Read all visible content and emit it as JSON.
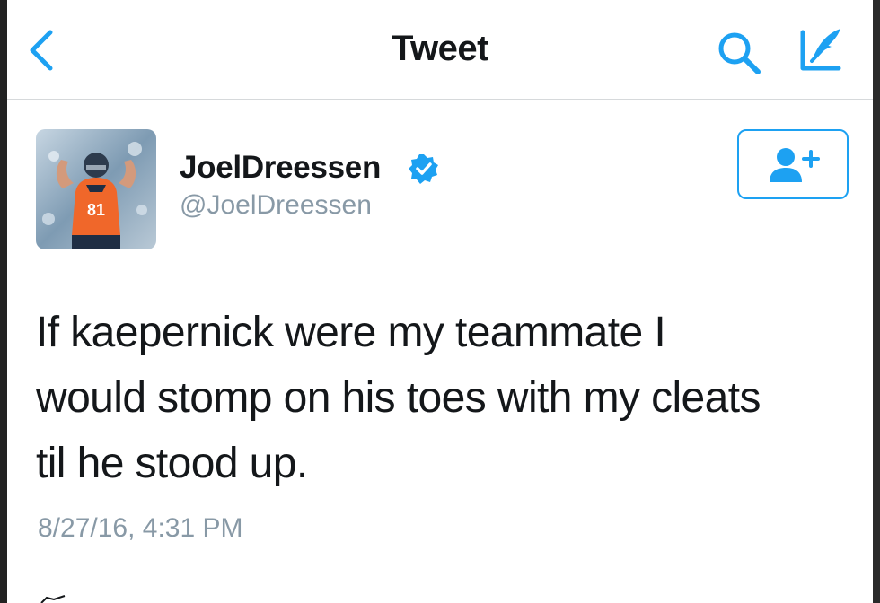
{
  "nav": {
    "title": "Tweet",
    "back_icon": "chevron-left-icon",
    "search_icon": "search-icon",
    "compose_icon": "compose-icon",
    "accent": "#1da1f2"
  },
  "tweet": {
    "author": {
      "name": "JoelDreessen",
      "handle": "@JoelDreessen",
      "verified": true,
      "avatar_jersey_number": "81"
    },
    "follow_icon": "add-user-icon",
    "text_lines": [
      "If kaepernick were my teammate I",
      "would stomp on his toes with my cleats",
      "til he stood up."
    ],
    "timestamp": "8/27/16, 4:31 PM"
  }
}
